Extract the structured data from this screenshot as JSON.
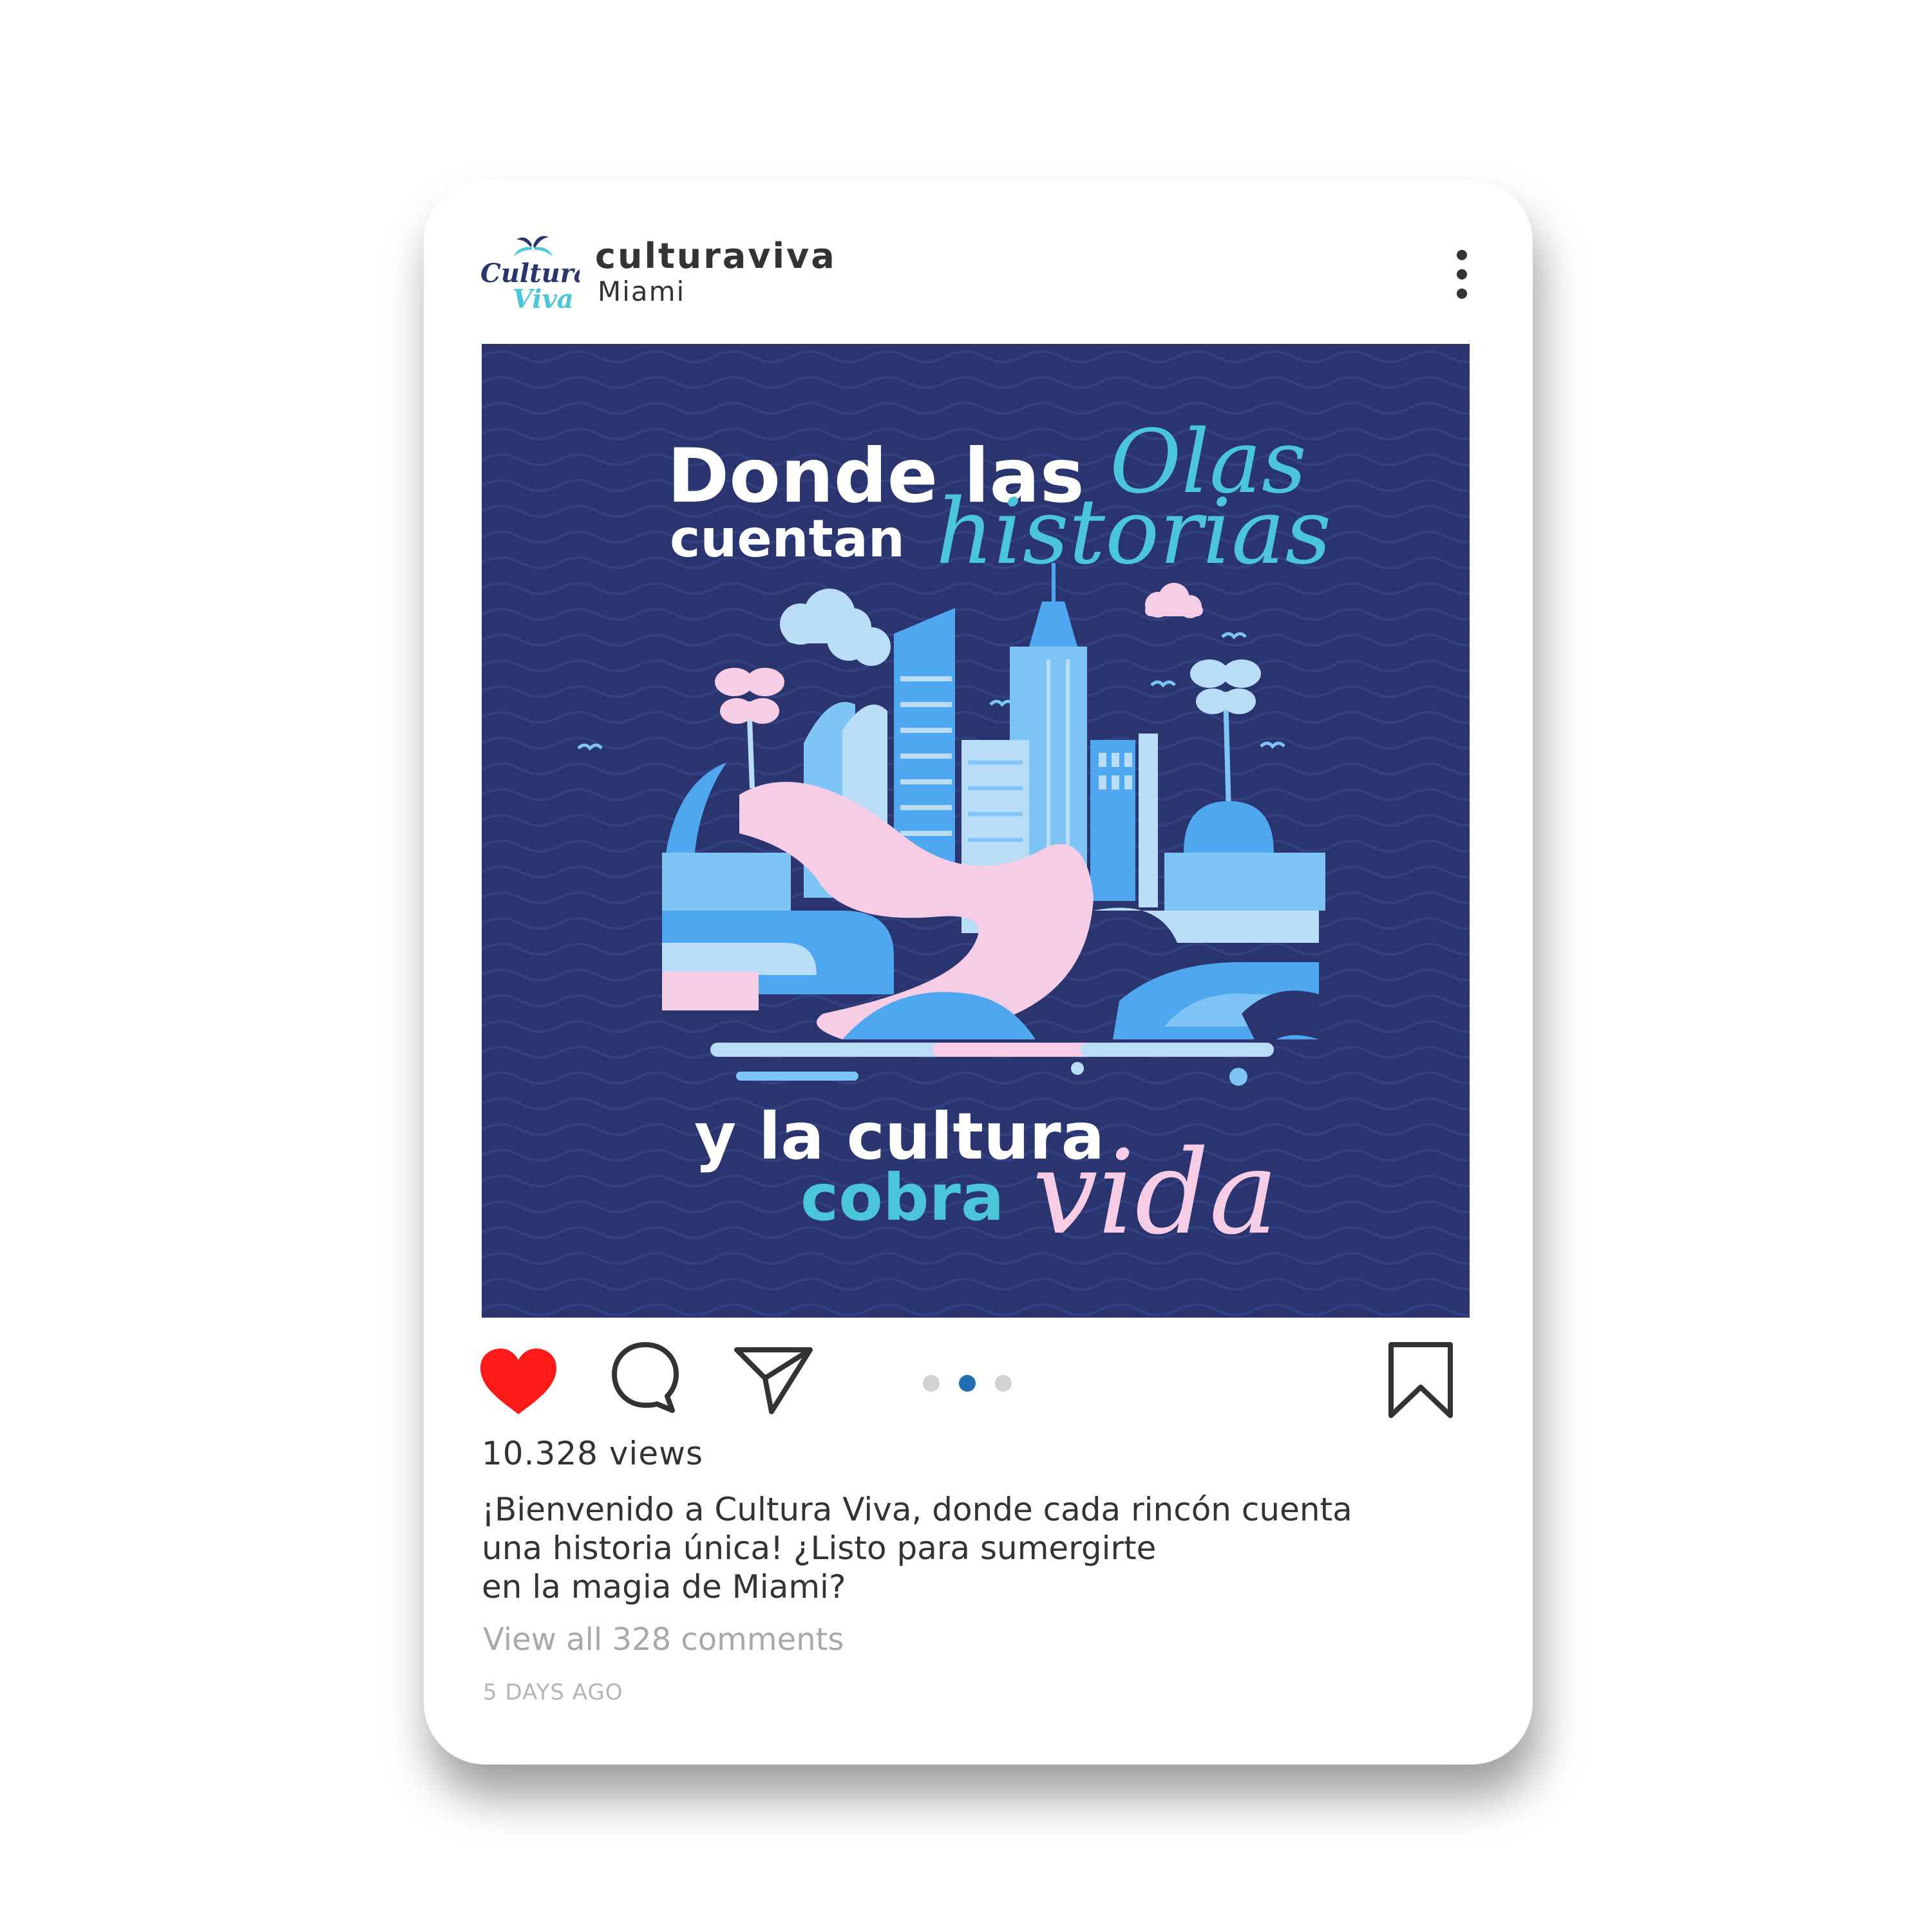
{
  "post": {
    "username": "culturaviva",
    "location": "Miami",
    "avatar_logo_text": [
      "Cultura",
      "Viva"
    ],
    "image": {
      "headline_line1": "Donde las",
      "headline_script1": "Olas",
      "headline_line2": "cuentan",
      "headline_script2": "historias",
      "footer_line1": "y la cultura",
      "footer_line2": "cobra",
      "footer_script": "vida"
    },
    "carousel": {
      "count": 3,
      "active_index": 1
    },
    "liked": true,
    "views": "10.328 views",
    "caption_lines": [
      "¡Bienvenido a Cultura Viva, donde cada rincón cuenta",
      "una historia única! ¿Listo para sumergirte",
      "en la magia de Miami?"
    ],
    "comments_link": "View all 328 comments",
    "timestamp": "5 DAYS AGO"
  },
  "icons": {
    "avatar": "culturaviva-logo",
    "more": "more-vertical-icon",
    "like": "heart-icon",
    "comment": "comment-bubble-icon",
    "share": "paper-plane-icon",
    "save": "bookmark-icon"
  },
  "colors": {
    "heart": "#ff1a1a",
    "image_background": "#2a3570",
    "carousel_active": "#1f6fb2",
    "carousel_inactive": "#d2d2d2",
    "accent_cyan": "#4bc6d8",
    "accent_pink": "#f7cde6"
  }
}
